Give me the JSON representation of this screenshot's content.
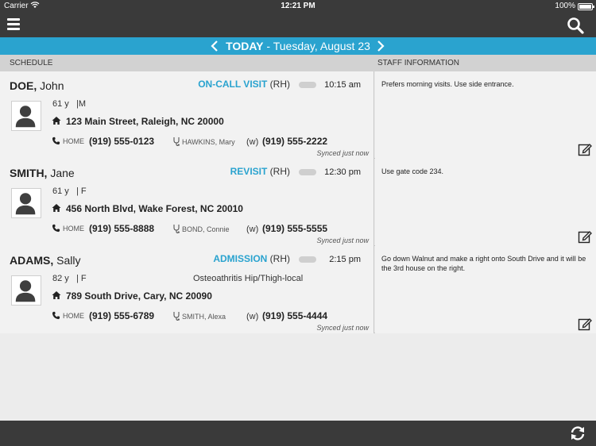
{
  "status": {
    "carrier": "Carrier",
    "time": "12:21 PM",
    "battery": "100%",
    "battery_level": 1.0
  },
  "datebar": {
    "today": "TODAY",
    "rest": " - Tuesday, August 23"
  },
  "columns": {
    "schedule": "SCHEDULE",
    "staff": "STAFF INFORMATION"
  },
  "visits": [
    {
      "last": "DOE,",
      "first": " John",
      "type": "ON-CALL VISIT",
      "code": " (RH)",
      "time": "10:15 am",
      "age": "61 y",
      "sex": "|M",
      "diagnosis": "",
      "address": "123 Main Street, Raleigh, NC 20000",
      "home_label": "HOME",
      "home_phone": "(919) 555-0123",
      "clinician": "HAWKINS, Mary",
      "work_label": "(w)",
      "work_phone": "(919) 555-2222",
      "synced": "Synced just now",
      "note": "Prefers morning visits. Use side entrance."
    },
    {
      "last": "SMITH,",
      "first": " Jane",
      "type": "REVISIT",
      "code": " (RH)",
      "time": "12:30 pm",
      "age": "61 y",
      "sex": "| F",
      "diagnosis": "",
      "address": "456 North Blvd, Wake Forest, NC 20010",
      "home_label": "HOME",
      "home_phone": "(919) 555-8888",
      "clinician": "BOND, Connie",
      "work_label": "(w)",
      "work_phone": "(919) 555-5555",
      "synced": "Synced just now",
      "note": "Use gate code 234."
    },
    {
      "last": "ADAMS,",
      "first": " Sally",
      "type": "ADMISSION",
      "code": " (RH)",
      "time": "2:15 pm",
      "age": "82 y",
      "sex": "| F",
      "diagnosis": "Osteoathritis Hip/Thigh-local",
      "address": "789 South Drive, Cary, NC 20090",
      "home_label": "HOME",
      "home_phone": "(919) 555-6789",
      "clinician": "SMITH, Alexa",
      "work_label": "(w)",
      "work_phone": "(919) 555-4444",
      "synced": "Synced just now",
      "note": "Go down Walnut and make a right onto South Drive and it will be the 3rd house on the right."
    }
  ],
  "icons": {
    "menu": "hamburger-menu-icon",
    "search": "search-icon",
    "prev": "chevron-left-icon",
    "next": "chevron-right-icon",
    "avatar": "person-silhouette-icon",
    "home": "house-icon",
    "phone": "phone-icon",
    "clinician": "stethoscope-icon",
    "edit": "edit-note-icon",
    "sync": "sync-icon"
  },
  "colors": {
    "accent": "#2aa3cf",
    "bar": "#3a3a3a",
    "row": "#f2f2f2",
    "header": "#d2d2d2"
  }
}
